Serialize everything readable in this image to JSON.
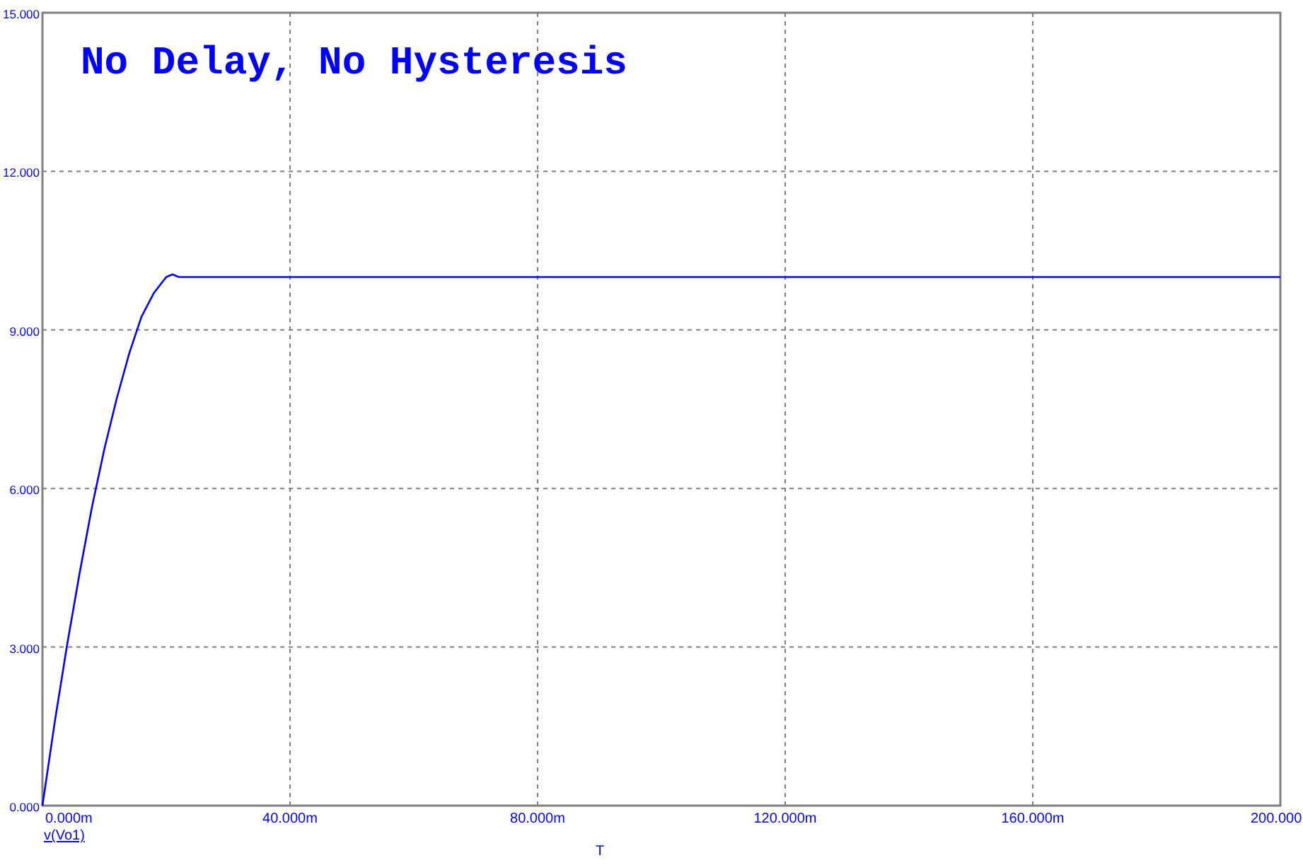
{
  "plot": {
    "chart_data": {
      "type": "line",
      "title": "No Delay, No Hysteresis",
      "xlabel": "T",
      "grid": true,
      "xlim": [
        0,
        200
      ],
      "ylim": [
        0,
        15
      ],
      "xticks": [
        {
          "value": 0,
          "label": "0.000m"
        },
        {
          "value": 40,
          "label": "40.000m"
        },
        {
          "value": 80,
          "label": "80.000m"
        },
        {
          "value": 120,
          "label": "120.000m"
        },
        {
          "value": 160,
          "label": "160.000m"
        },
        {
          "value": 200,
          "label": "200.000"
        }
      ],
      "yticks": [
        {
          "value": 0,
          "label": "0.000"
        },
        {
          "value": 3,
          "label": "3.000"
        },
        {
          "value": 6,
          "label": "6.000"
        },
        {
          "value": 9,
          "label": "9.000"
        },
        {
          "value": 12,
          "label": "12.000"
        },
        {
          "value": 15,
          "label": "15.000"
        }
      ],
      "x": [
        0,
        2,
        4,
        6,
        8,
        10,
        12,
        14,
        16,
        18,
        20,
        21,
        22,
        200
      ],
      "series": [
        {
          "name": "v(Vo1)",
          "color": "#0000ff",
          "values": [
            0,
            1.6,
            3.05,
            4.4,
            5.65,
            6.75,
            7.7,
            8.55,
            9.25,
            9.7,
            10.0,
            10.05,
            10.0,
            10.0
          ]
        }
      ]
    }
  }
}
